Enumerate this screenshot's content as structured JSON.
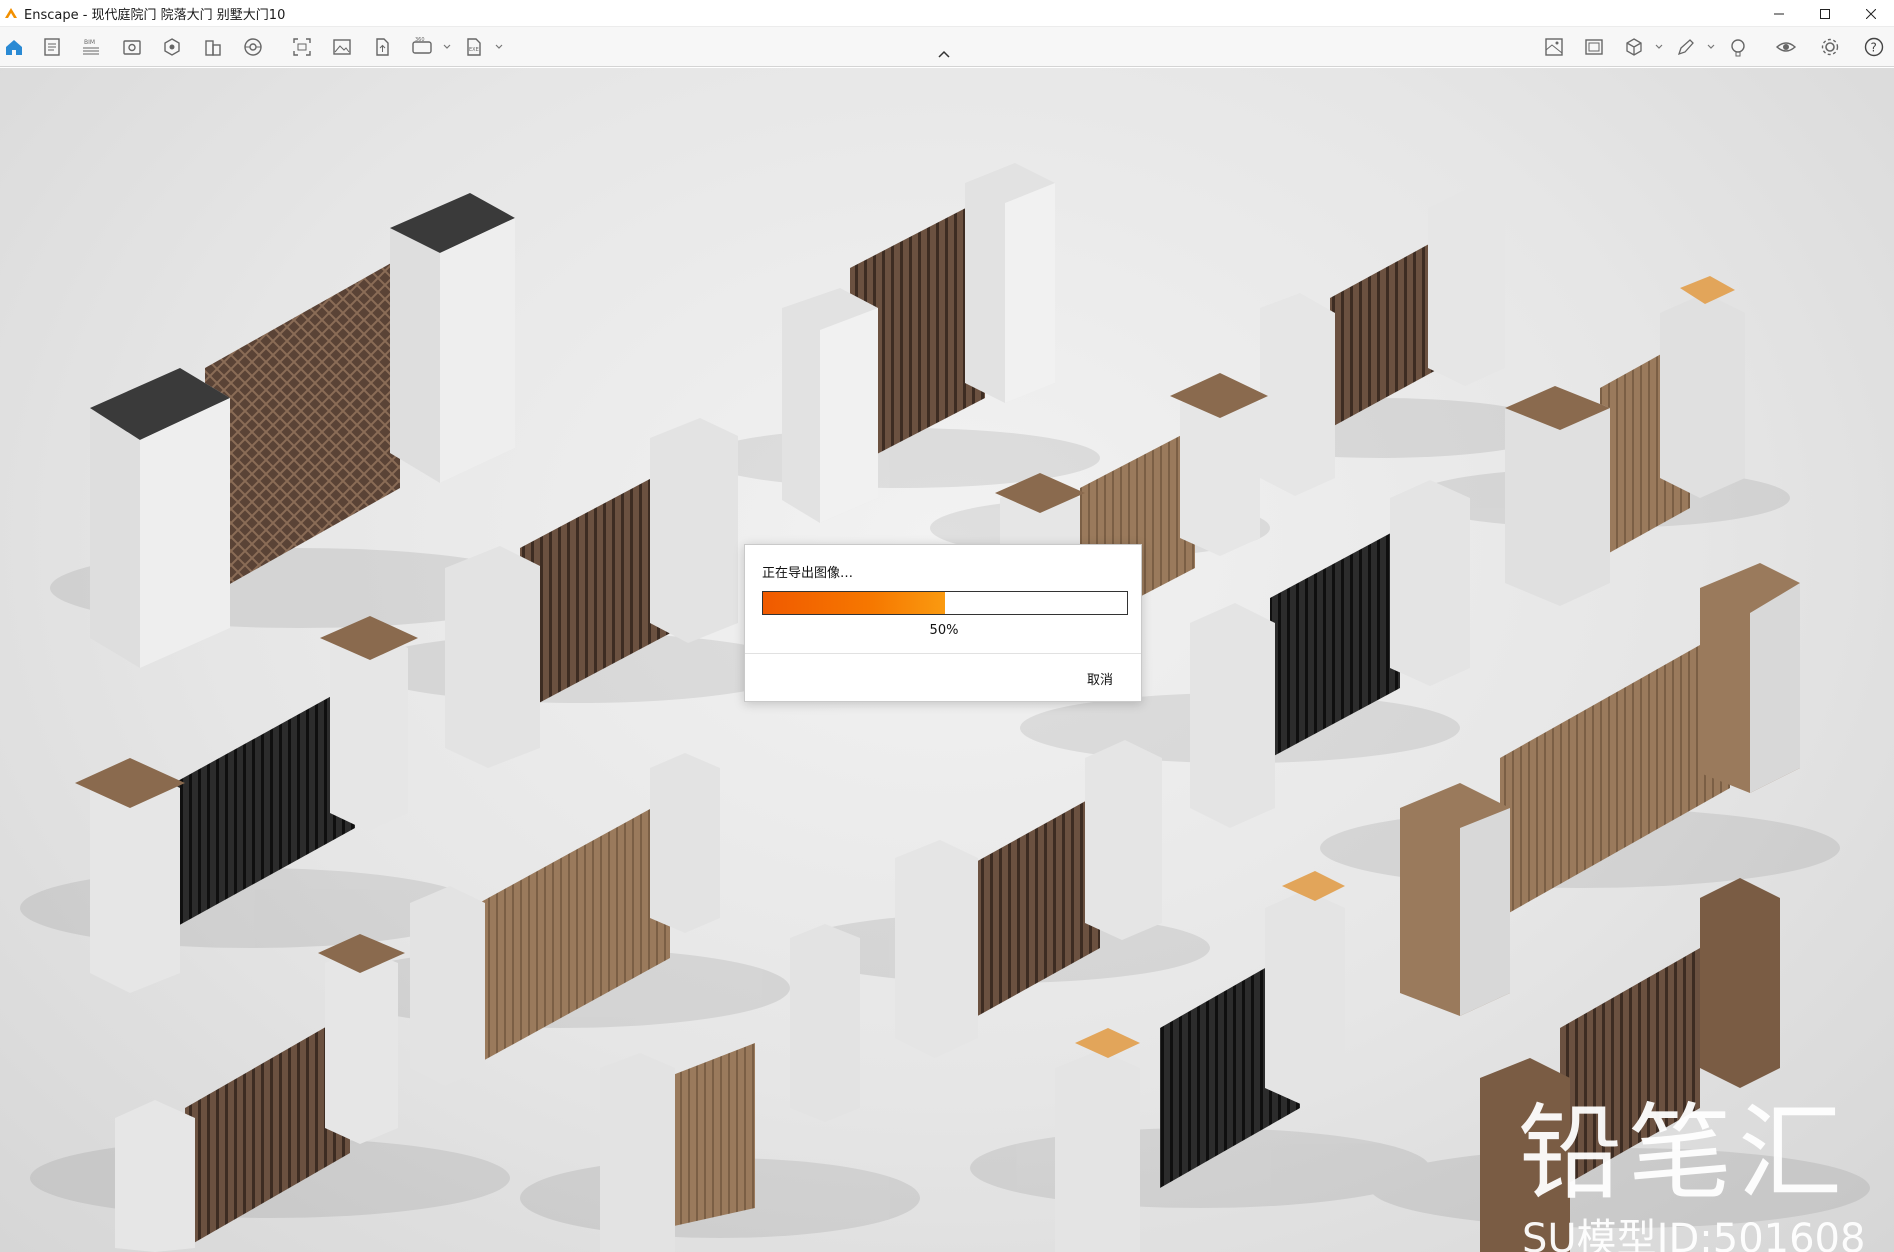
{
  "window": {
    "title": "Enscape - 现代庭院门 院落大门 别墅大门10",
    "minimize_icon": "minimize-icon",
    "maximize_icon": "maximize-icon",
    "close_icon": "close-icon"
  },
  "toolbar": {
    "left_icons": [
      "home-icon",
      "document-icon",
      "bim-icon",
      "view-icon",
      "object-icon",
      "building-icon",
      "asset-library-icon",
      "screenshot-icon",
      "image-icon",
      "upload-icon",
      "panorama-360-icon",
      "export-icon"
    ],
    "bim_label": "BIM",
    "panorama_label": "360",
    "exe_label": "EXE",
    "right_icons": [
      "minimap-icon",
      "capture-icon",
      "cube-view-icon",
      "pen-tool-icon",
      "sync-icon",
      "eye-icon",
      "settings-icon",
      "help-icon"
    ],
    "accent_color": "#2a8ad4"
  },
  "export_dialog": {
    "title": "正在导出图像…",
    "progress": 0.5,
    "progress_label": "50%",
    "cancel_label": "取消",
    "fill_color": "#f36b00"
  },
  "watermark": {
    "brand": "铅笔汇",
    "model_id": "SU模型ID:501608"
  }
}
